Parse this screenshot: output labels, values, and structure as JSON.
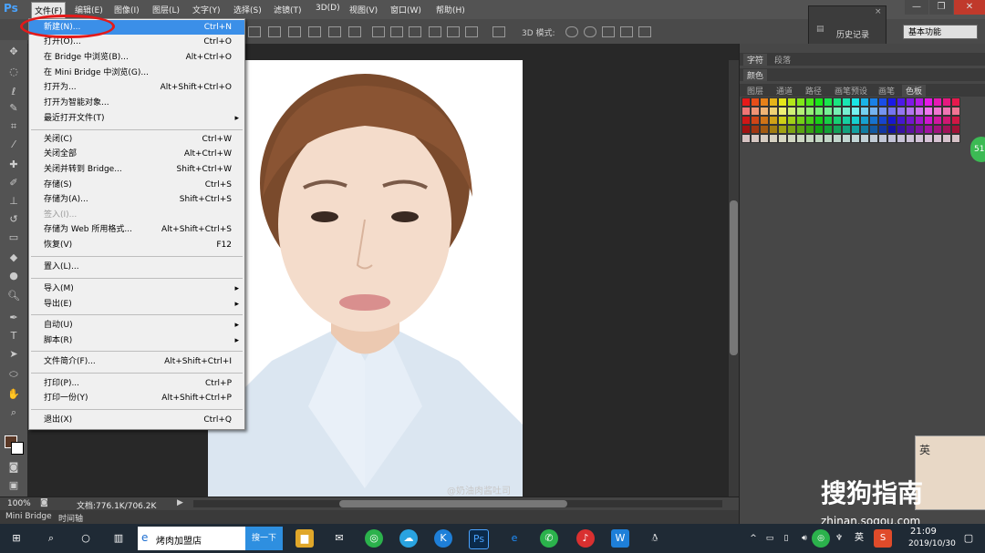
{
  "app": {
    "logo": "Ps"
  },
  "menubar": [
    {
      "id": "file",
      "label": "文件(F)"
    },
    {
      "id": "edit",
      "label": "编辑(E)"
    },
    {
      "id": "image",
      "label": "图像(I)"
    },
    {
      "id": "layer",
      "label": "图层(L)"
    },
    {
      "id": "type",
      "label": "文字(Y)"
    },
    {
      "id": "select",
      "label": "选择(S)"
    },
    {
      "id": "filter",
      "label": "滤镜(T)"
    },
    {
      "id": "3d",
      "label": "3D(D)"
    },
    {
      "id": "view",
      "label": "视图(V)"
    },
    {
      "id": "window",
      "label": "窗口(W)"
    },
    {
      "id": "help",
      "label": "帮助(H)"
    }
  ],
  "options": {
    "mode3d": "3D 模式:",
    "workspace": "基本功能"
  },
  "history": {
    "label": "历史记录"
  },
  "file_menu": [
    {
      "label": "新建(N)...",
      "shortcut": "Ctrl+N",
      "highlighted": true
    },
    {
      "label": "打开(O)...",
      "shortcut": "Ctrl+O"
    },
    {
      "label": "在 Bridge 中浏览(B)...",
      "shortcut": "Alt+Ctrl+O"
    },
    {
      "label": "在 Mini Bridge 中浏览(G)...",
      "shortcut": ""
    },
    {
      "label": "打开为...",
      "shortcut": "Alt+Shift+Ctrl+O"
    },
    {
      "label": "打开为智能对象...",
      "shortcut": ""
    },
    {
      "label": "最近打开文件(T)",
      "shortcut": "▸"
    },
    {
      "label": "关闭(C)",
      "shortcut": "Ctrl+W"
    },
    {
      "label": "关闭全部",
      "shortcut": "Alt+Ctrl+W"
    },
    {
      "label": "关闭并转到 Bridge...",
      "shortcut": "Shift+Ctrl+W"
    },
    {
      "label": "存储(S)",
      "shortcut": "Ctrl+S"
    },
    {
      "label": "存储为(A)...",
      "shortcut": "Shift+Ctrl+S"
    },
    {
      "label": "签入(I)...",
      "shortcut": "",
      "disabled": true
    },
    {
      "label": "存储为 Web 所用格式...",
      "shortcut": "Alt+Shift+Ctrl+S"
    },
    {
      "label": "恢复(V)",
      "shortcut": "F12"
    },
    {
      "label": "置入(L)...",
      "shortcut": ""
    },
    {
      "label": "导入(M)",
      "shortcut": "▸"
    },
    {
      "label": "导出(E)",
      "shortcut": "▸"
    },
    {
      "label": "自动(U)",
      "shortcut": "▸"
    },
    {
      "label": "脚本(R)",
      "shortcut": "▸"
    },
    {
      "label": "文件简介(F)...",
      "shortcut": "Alt+Shift+Ctrl+I"
    },
    {
      "label": "打印(P)...",
      "shortcut": "Ctrl+P"
    },
    {
      "label": "打印一份(Y)",
      "shortcut": "Alt+Shift+Ctrl+P"
    },
    {
      "label": "退出(X)",
      "shortcut": "Ctrl+Q"
    }
  ],
  "status": {
    "zoom": "100%",
    "doc": "文档:776.1K/706.2K"
  },
  "bottom_tabs": [
    "Mini Bridge",
    "时间轴"
  ],
  "panels": {
    "row1": [
      "字符",
      "段落"
    ],
    "row2": [
      "颜色"
    ],
    "row3": [
      "图层",
      "通道",
      "路径",
      "画笔预设",
      "画笔",
      "色板"
    ]
  },
  "watermark": "@奶油肉酱吐司",
  "taskbar": {
    "search_text": "烤肉加盟店",
    "search_button": "搜一下",
    "ime": "英",
    "time": "21:09",
    "date": "2019/10/30"
  },
  "sogou": {
    "brand": "搜狗指南",
    "url": "zhinan.sogou.com",
    "badge": "英"
  },
  "side_badge": "51"
}
